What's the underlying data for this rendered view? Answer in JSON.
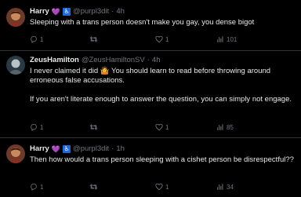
{
  "tweets": [
    {
      "name": "Harry",
      "handle": "@purpl3dit",
      "separator": "·",
      "time": "4h",
      "heart_badge": "💜",
      "wheelchair_badge": "♿",
      "text": "Sleeping with a trans person doesn't make you gay, you dense bigot",
      "replies": "1",
      "reposts": "",
      "likes": "1",
      "views": "101"
    },
    {
      "name": "ZeusHamilton",
      "handle": "@ZeusHamiltonSV",
      "separator": "·",
      "time": "4h",
      "text_line1": "I never claimed it did 🤷 You should learn to read before throwing around erroneous false accusations.",
      "text_line2": "If you aren't literate enough to answer the question, you can simply not engage.",
      "replies": "1",
      "reposts": "",
      "likes": "1",
      "views": "85"
    },
    {
      "name": "Harry",
      "handle": "@purpl3dit",
      "separator": "·",
      "time": "1h",
      "heart_badge": "💜",
      "wheelchair_badge": "♿",
      "text": "Then how would a trans person sleeping with a cishet person be disrespectful??",
      "replies": "1",
      "reposts": "",
      "likes": "1",
      "views": "34"
    }
  ],
  "icons": {
    "reply": "reply-icon",
    "repost": "repost-icon",
    "like": "heart-icon",
    "views": "views-icon"
  },
  "colors": {
    "background": "#000000",
    "text": "#e7e9ea",
    "muted": "#71767b",
    "divider": "#2f3336"
  }
}
